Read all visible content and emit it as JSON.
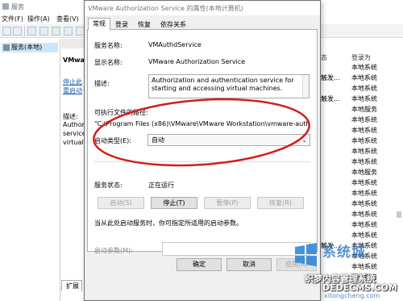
{
  "background": {
    "window_title": "服务",
    "menu": [
      "文件(F)",
      "操作(A)",
      "查看(V)"
    ],
    "tree_item": "服务(本地)",
    "middle_panel": {
      "service_name_partial": "VMwa",
      "link1": "停止此",
      "link2": "重启动",
      "desc_label": "描述:",
      "desc_lines": [
        "Authoriz",
        "service",
        "virtual"
      ]
    },
    "extension_tab": "扩展",
    "columns": {
      "status": "态",
      "login_as": "登录为"
    },
    "rows": [
      {
        "status": "",
        "login_as": "本地系统"
      },
      {
        "status": "触发...",
        "login_as": "本地系统"
      },
      {
        "status": "",
        "login_as": "本地系统"
      },
      {
        "status": "触发...",
        "login_as": "本地系统"
      },
      {
        "status": "",
        "login_as": "本地服务"
      },
      {
        "status": "",
        "login_as": "本地系统"
      },
      {
        "status": "",
        "login_as": "本地系统"
      },
      {
        "status": "",
        "login_as": "本地系统"
      },
      {
        "status": "",
        "login_as": "本地系统"
      },
      {
        "status": "",
        "login_as": "本地系统"
      },
      {
        "status": "",
        "login_as": "本地服务"
      },
      {
        "status": "",
        "login_as": "本地系统"
      },
      {
        "status": "",
        "login_as": "本地系统"
      },
      {
        "status": "",
        "login_as": "本地系统"
      },
      {
        "status": "",
        "login_as": "本地系统"
      },
      {
        "status": "",
        "login_as": "本地系统"
      },
      {
        "status": "",
        "login_as": "本地系统"
      },
      {
        "status": "触发...",
        "login_as": "本地系统"
      },
      {
        "status": "",
        "login_as": "本地系统"
      },
      {
        "status": "",
        "login_as": "本地系统"
      },
      {
        "status": "",
        "login_as": "网络服务"
      }
    ]
  },
  "dialog": {
    "title": "VMware Authorization Service 的属性(本地计算机)",
    "tabs": [
      "常规",
      "登录",
      "恢复",
      "依存关系"
    ],
    "service_name_label": "服务名称:",
    "service_name_value": "VMAuthdService",
    "display_name_label": "显示名称:",
    "display_name_value": "VMware Authorization Service",
    "description_label": "描述:",
    "description_value": "Authorization and authentication service for starting and accessing virtual machines.",
    "exec_path_label": "可执行文件的路径:",
    "exec_path_value": "\"C:\\Program Files (x86)\\VMware\\VMware Workstation\\vmware-authd.exe",
    "startup_type_label": "启动类型(E):",
    "startup_type_value": "自动",
    "service_status_label": "服务状态:",
    "service_status_value": "正在运行",
    "buttons": {
      "start": "启动(S)",
      "stop": "停止(T)",
      "pause": "暂停(P)",
      "resume": "恢复(R)"
    },
    "hint": "当从此处启动服务时，你可指定所适用的启动参数。",
    "start_params_label": "启动参数(M):",
    "ok": "确定",
    "cancel": "取消",
    "apply": "应用(A)"
  },
  "annotation_color": "#d41d1d",
  "watermark": {
    "brand": "系统城",
    "line1": "织梦内容管理系统",
    "line2": "DEDECMS.COM",
    "line3": "xitongcheng.com"
  }
}
